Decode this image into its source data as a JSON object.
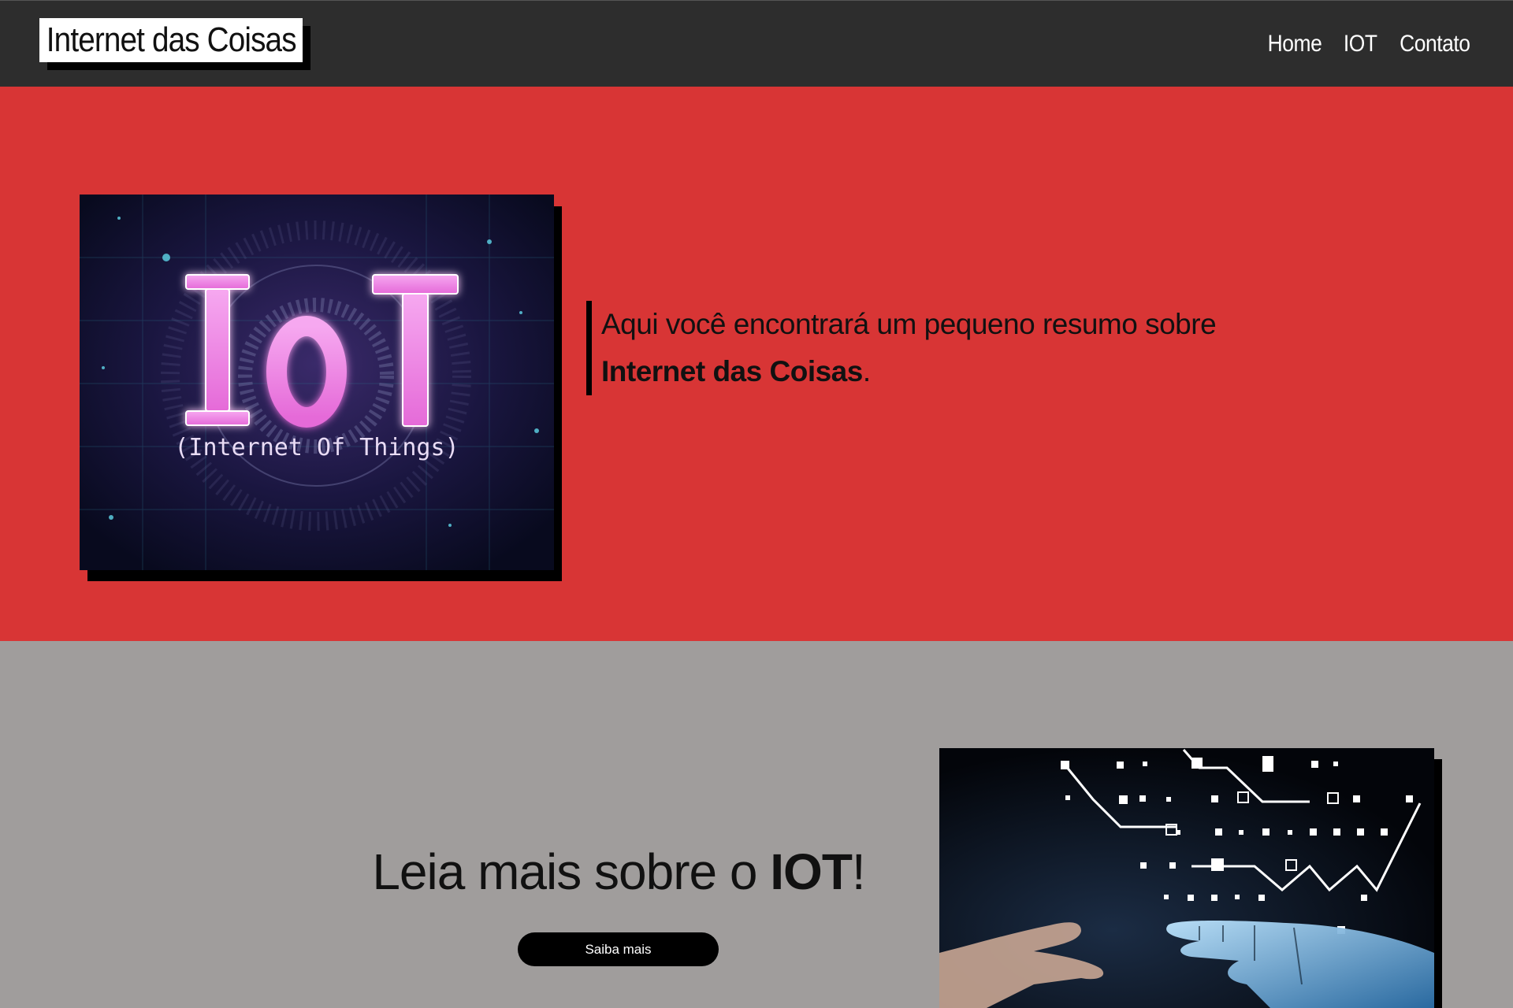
{
  "header": {
    "logo": "Internet das Coisas",
    "nav": [
      "Home",
      "IOT",
      "Contato"
    ]
  },
  "hero": {
    "image_text_main": "IoT",
    "image_text_sub": "(Internet Of Things)",
    "text_before": "Aqui você encontrará um pequeno resumo sobre ",
    "text_bold": "Internet das Coisas",
    "text_after": "."
  },
  "read_more": {
    "text_before": "Leia mais sobre o ",
    "text_bold": "IOT",
    "text_after": "!",
    "button_label": "Saiba mais"
  },
  "colors": {
    "header_bg": "#2d2d2d",
    "hero_bg": "#d83535",
    "section_bg": "#a09d9c",
    "button_bg": "#000000"
  }
}
